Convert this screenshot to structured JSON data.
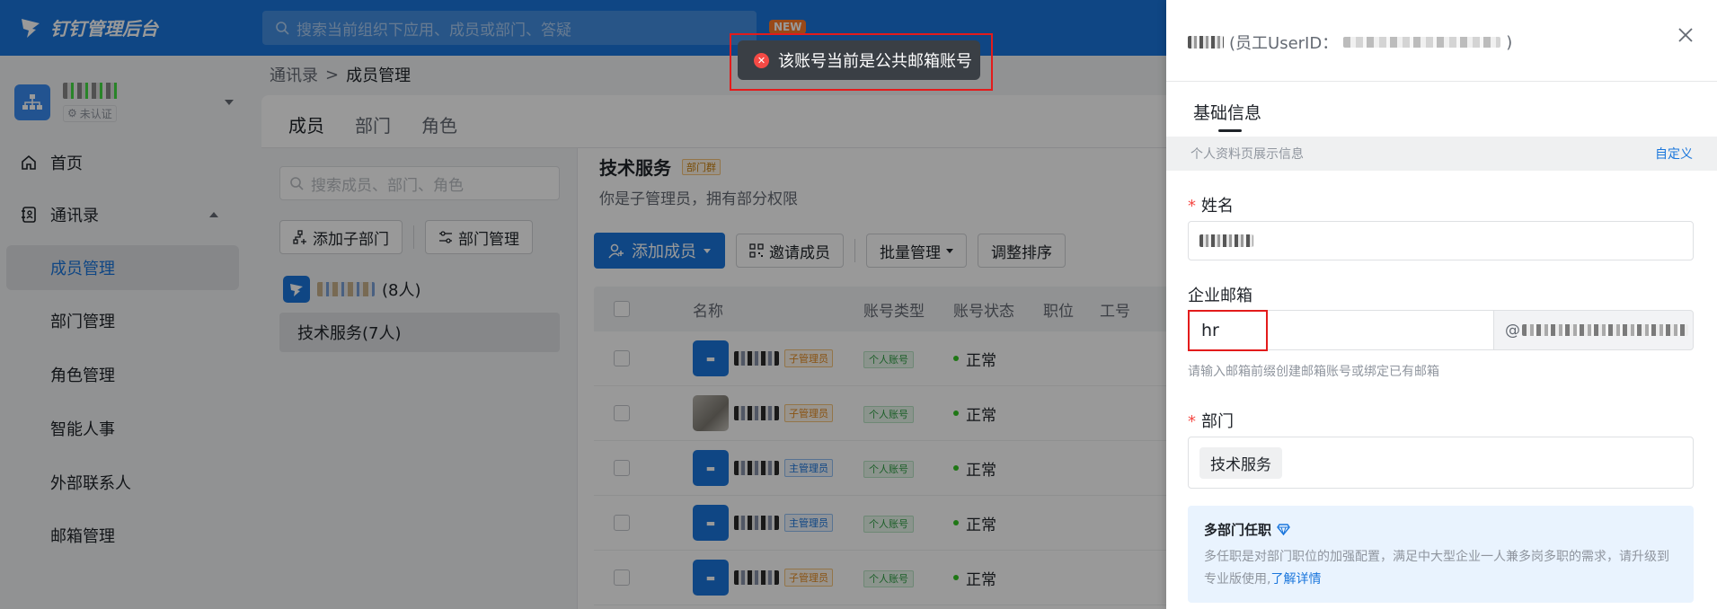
{
  "app": {
    "title": "钉钉管理后台",
    "search_placeholder": "搜索当前组织下应用、成员或部门、答疑",
    "new_badge": "NEW"
  },
  "org": {
    "status": "未认证"
  },
  "sidebar": {
    "items": [
      {
        "label": "首页",
        "icon": "home-icon"
      },
      {
        "label": "通讯录",
        "icon": "contacts-icon"
      },
      {
        "label": "成员管理",
        "active": true
      },
      {
        "label": "部门管理"
      },
      {
        "label": "角色管理"
      },
      {
        "label": "智能人事"
      },
      {
        "label": "外部联系人"
      },
      {
        "label": "邮箱管理"
      }
    ]
  },
  "breadcrumb": {
    "parent": "通讯录",
    "sep": ">",
    "current": "成员管理"
  },
  "tabs": [
    "成员",
    "部门",
    "角色"
  ],
  "dept_pane": {
    "search_placeholder": "搜索成员、部门、角色",
    "add_sub_label": "添加子部门",
    "manage_label": "部门管理",
    "root_count": "(8人)",
    "child_label": "技术服务(7人)"
  },
  "members": {
    "dept_title": "技术服务",
    "dept_tag": "部门群",
    "subtitle": "你是子管理员，拥有部分权限",
    "add_label": "添加成员",
    "invite_label": "邀请成员",
    "batch_label": "批量管理",
    "sort_label": "调整排序",
    "columns": [
      "名称",
      "账号类型",
      "账号状态",
      "职位",
      "工号"
    ],
    "rows": [
      {
        "role": "子管理员",
        "role_kind": "sub",
        "type": "个人账号",
        "status": "正常"
      },
      {
        "role": "子管理员",
        "role_kind": "sub",
        "type": "个人账号",
        "status": "正常"
      },
      {
        "role": "主管理员",
        "role_kind": "main",
        "type": "个人账号",
        "status": "正常"
      },
      {
        "role": "主管理员",
        "role_kind": "main",
        "type": "个人账号",
        "status": "正常"
      },
      {
        "role": "子管理员",
        "role_kind": "sub",
        "type": "个人账号",
        "status": "正常"
      }
    ]
  },
  "toast": {
    "message": "该账号当前是公共邮箱账号"
  },
  "drawer": {
    "header_prefix": "(员工UserID：",
    "header_suffix": ")",
    "tab": "基础信息",
    "band_text": "个人资料页展示信息",
    "band_link": "自定义",
    "name_label": "姓名",
    "email_label": "企业邮箱",
    "email_value": "hr",
    "email_at": "@",
    "email_hint": "请输入邮箱前缀创建邮箱账号或绑定已有邮箱",
    "dept_label": "部门",
    "dept_value": "技术服务",
    "multi_title": "多部门任职",
    "multi_desc": "多任职是对部门职位的加强配置，满足中大型企业一人兼多岗多职的需求，请升级到专业版使用,",
    "multi_link": "了解详情"
  },
  "colors": {
    "brand": "#1a76dc",
    "danger": "#f54a45",
    "success": "#34c724"
  }
}
